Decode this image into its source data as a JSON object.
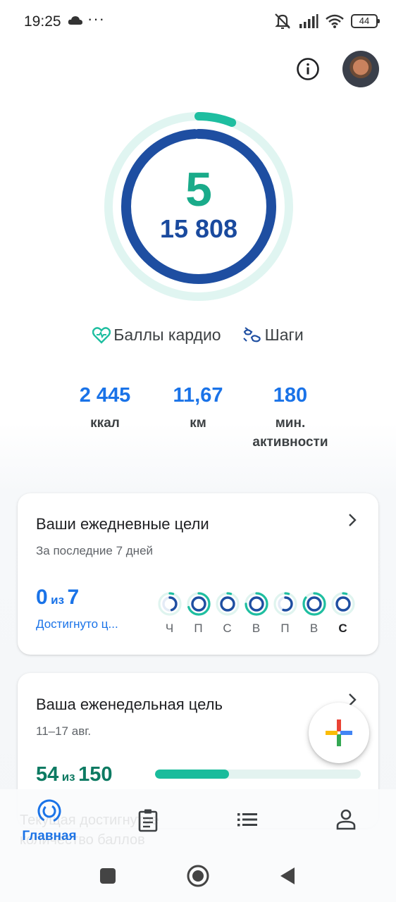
{
  "status_bar": {
    "time": "19:25",
    "dots": "···",
    "battery": "44"
  },
  "summary": {
    "heart_points": "5",
    "steps": "15 808",
    "heart_points_progress": 0.06,
    "steps_progress": 0.99
  },
  "legend": {
    "cardio_label": "Баллы кардио",
    "steps_label": "Шаги"
  },
  "stats": [
    {
      "value": "2 445",
      "label": "ккал"
    },
    {
      "value": "11,67",
      "label": "км"
    },
    {
      "value": "180",
      "label": "мин. активности"
    }
  ],
  "daily_goals": {
    "title": "Ваши ежедневные цели",
    "subtitle": "За последние 7 дней",
    "achieved": "0",
    "of_word": "из",
    "total": "7",
    "link": "Достигнуто ц...",
    "days": [
      {
        "label": "Ч",
        "outer": 0.05,
        "inner": 0.45
      },
      {
        "label": "П",
        "outer": 0.7,
        "inner": 1.0
      },
      {
        "label": "С",
        "outer": 0.05,
        "inner": 1.0
      },
      {
        "label": "В",
        "outer": 0.75,
        "inner": 1.0
      },
      {
        "label": "П",
        "outer": 0.05,
        "inner": 0.55
      },
      {
        "label": "В",
        "outer": 0.85,
        "inner": 1.0
      },
      {
        "label": "С",
        "outer": 0.05,
        "inner": 1.0
      }
    ]
  },
  "weekly_goal": {
    "title": "Ваша еженедельная цель",
    "date_range": "11–17 авг.",
    "achieved": "54",
    "of_word": "из",
    "target": "150",
    "progress": 0.36,
    "hidden_text": "Текущая достигнутое количество баллов"
  },
  "bottom_nav": {
    "home_label": "Главная"
  },
  "colors": {
    "accent_blue": "#1a73e8",
    "ring_blue": "#1e4ea1",
    "teal": "#1abc9c",
    "teal_light": "#e0f5f1"
  }
}
